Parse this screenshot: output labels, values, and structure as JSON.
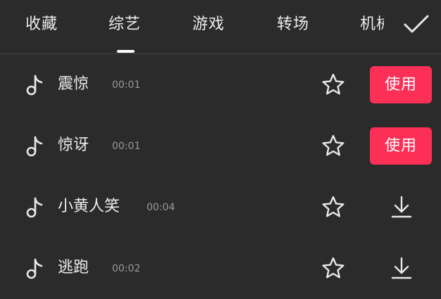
{
  "tabs": [
    {
      "label": "收藏"
    },
    {
      "label": "综艺"
    },
    {
      "label": "游戏"
    },
    {
      "label": "转场"
    },
    {
      "label": "机械"
    }
  ],
  "active_tab_index": 1,
  "confirm_icon": "checkmark-icon",
  "accent_color": "#fc2f57",
  "items": [
    {
      "title": "震惊",
      "duration": "00:01",
      "action": "use",
      "action_label": "使用"
    },
    {
      "title": "惊讶",
      "duration": "00:01",
      "action": "use",
      "action_label": "使用"
    },
    {
      "title": "小黄人笑",
      "duration": "00:04",
      "action": "download"
    },
    {
      "title": "逃跑",
      "duration": "00:02",
      "action": "download"
    }
  ]
}
